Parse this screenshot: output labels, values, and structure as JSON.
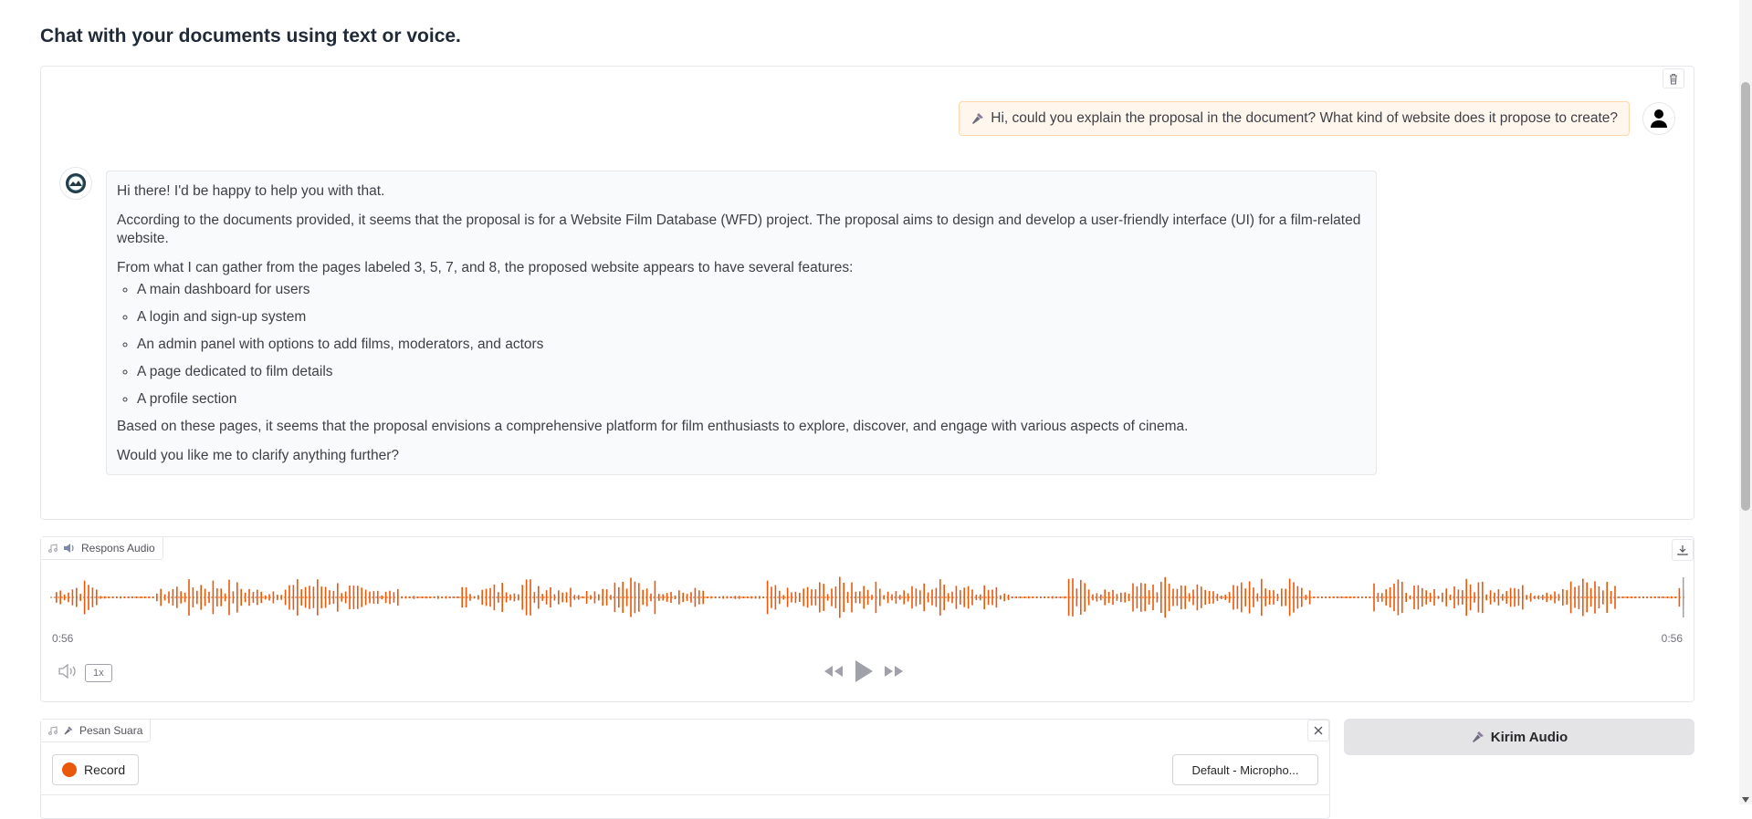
{
  "page": {
    "title": "Chat with your documents using text or voice."
  },
  "chat": {
    "user_message": "Hi, could you explain the proposal in the document? What kind of website does it propose to create?",
    "bot_intro": "Hi there! I'd be happy to help you with that.",
    "bot_p1": "According to the documents provided, it seems that the proposal is for a Website Film Database (WFD) project. The proposal aims to design and develop a user-friendly interface (UI) for a film-related website.",
    "bot_p2": "From what I can gather from the pages labeled 3, 5, 7, and 8, the proposed website appears to have several features:",
    "bot_list": [
      "A main dashboard for users",
      "A login and sign-up system",
      "An admin panel with options to add films, moderators, and actors",
      "A page dedicated to film details",
      "A profile section"
    ],
    "bot_p3": "Based on these pages, it seems that the proposal envisions a comprehensive platform for film enthusiasts to explore, discover, and engage with various aspects of cinema.",
    "bot_p4": "Would you like me to clarify anything further?"
  },
  "audio_output": {
    "label": "Respons Audio",
    "time_current": "0:56",
    "time_total": "0:56",
    "speed": "1x",
    "wave_color": "#ea580c"
  },
  "voice_input": {
    "label": "Pesan Suara",
    "record_label": "Record",
    "microphone": "Default - Micropho..."
  },
  "send_button": {
    "label": "Kirim Audio"
  },
  "icons": {
    "mic": "microphone-icon",
    "speaker": "speaker-icon",
    "music": "music-note-icon"
  }
}
